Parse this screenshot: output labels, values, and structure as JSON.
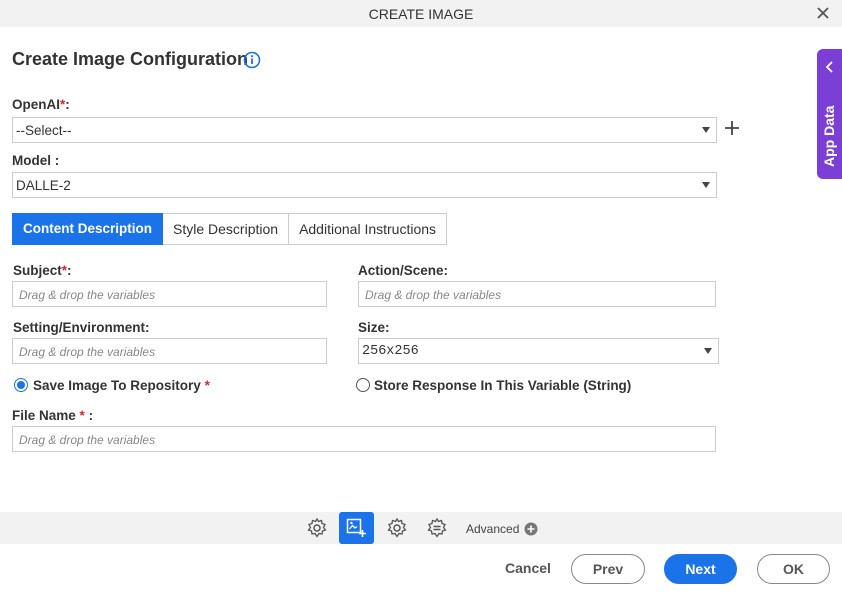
{
  "window": {
    "title": "CREATE IMAGE"
  },
  "page": {
    "heading": "Create Image Configuration"
  },
  "openai": {
    "label": "OpenAI",
    "required_mark": "*",
    "suffix": ":",
    "value": "--Select--"
  },
  "model": {
    "label": "Model :",
    "value": "DALLE-2"
  },
  "tabs": [
    {
      "label": "Content Description",
      "active": true
    },
    {
      "label": "Style Description",
      "active": false
    },
    {
      "label": "Additional Instructions",
      "active": false
    }
  ],
  "subject": {
    "label": "Subject",
    "required_mark": "*",
    "suffix": ":",
    "placeholder": "Drag & drop the variables"
  },
  "action_scene": {
    "label": "Action/Scene:",
    "placeholder": "Drag & drop the variables"
  },
  "setting": {
    "label": "Setting/Environment:",
    "placeholder": "Drag & drop the variables"
  },
  "size": {
    "label": "Size:",
    "value": "256x256"
  },
  "save_option": {
    "label": "Save Image To Repository",
    "required_mark": "*",
    "selected": true
  },
  "store_option": {
    "label": "Store Response In This Variable (String)",
    "selected": false
  },
  "file_name": {
    "label": "File Name",
    "required_mark": "*",
    "suffix": ":",
    "placeholder": "Drag & drop the variables"
  },
  "side_panel": {
    "label": "App Data"
  },
  "footer": {
    "advanced_label": "Advanced",
    "cancel_label": "Cancel",
    "prev_label": "Prev",
    "next_label": "Next",
    "ok_label": "OK"
  },
  "colors": {
    "accent": "#1a73e8",
    "side_panel": "#7b3fd6",
    "required": "#d9262c"
  },
  "icons": [
    "close-icon",
    "info-icon",
    "plus-icon",
    "chevron-left-icon",
    "gear-icon",
    "image-add-icon",
    "settings-cog-icon",
    "list-settings-icon",
    "plus-circle-icon"
  ]
}
